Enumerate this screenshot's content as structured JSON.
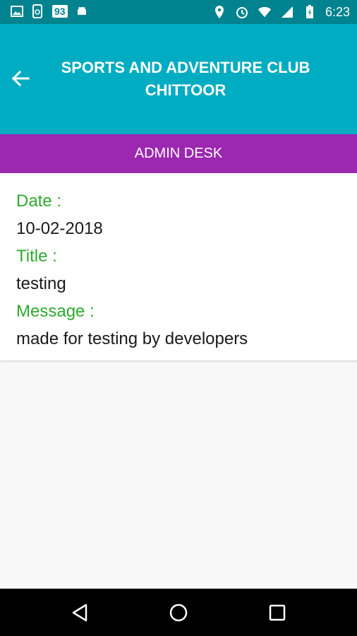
{
  "status_bar": {
    "badge_number": "93",
    "time": "6:23",
    "icons": [
      "image-icon",
      "phone-sync-icon",
      "android-icon",
      "location-icon",
      "alarm-icon",
      "wifi-icon",
      "signal-icon",
      "battery-icon"
    ]
  },
  "app_bar": {
    "title": "SPORTS AND ADVENTURE CLUB CHITTOOR",
    "back_icon": "arrow-back-icon"
  },
  "section": {
    "title": "ADMIN DESK"
  },
  "notice": {
    "date_label": "Date :",
    "date_value": "10-02-2018",
    "title_label": "Title :",
    "title_value": "testing",
    "message_label": "Message :",
    "message_value": "made for testing by developers"
  },
  "nav_bar": {
    "icons": [
      "back-triangle-icon",
      "home-circle-icon",
      "recents-square-icon"
    ]
  },
  "colors": {
    "status_bar": "#00838f",
    "app_bar": "#00acc1",
    "section_bar": "#9c27b0",
    "label_green": "#2eaa2e"
  }
}
